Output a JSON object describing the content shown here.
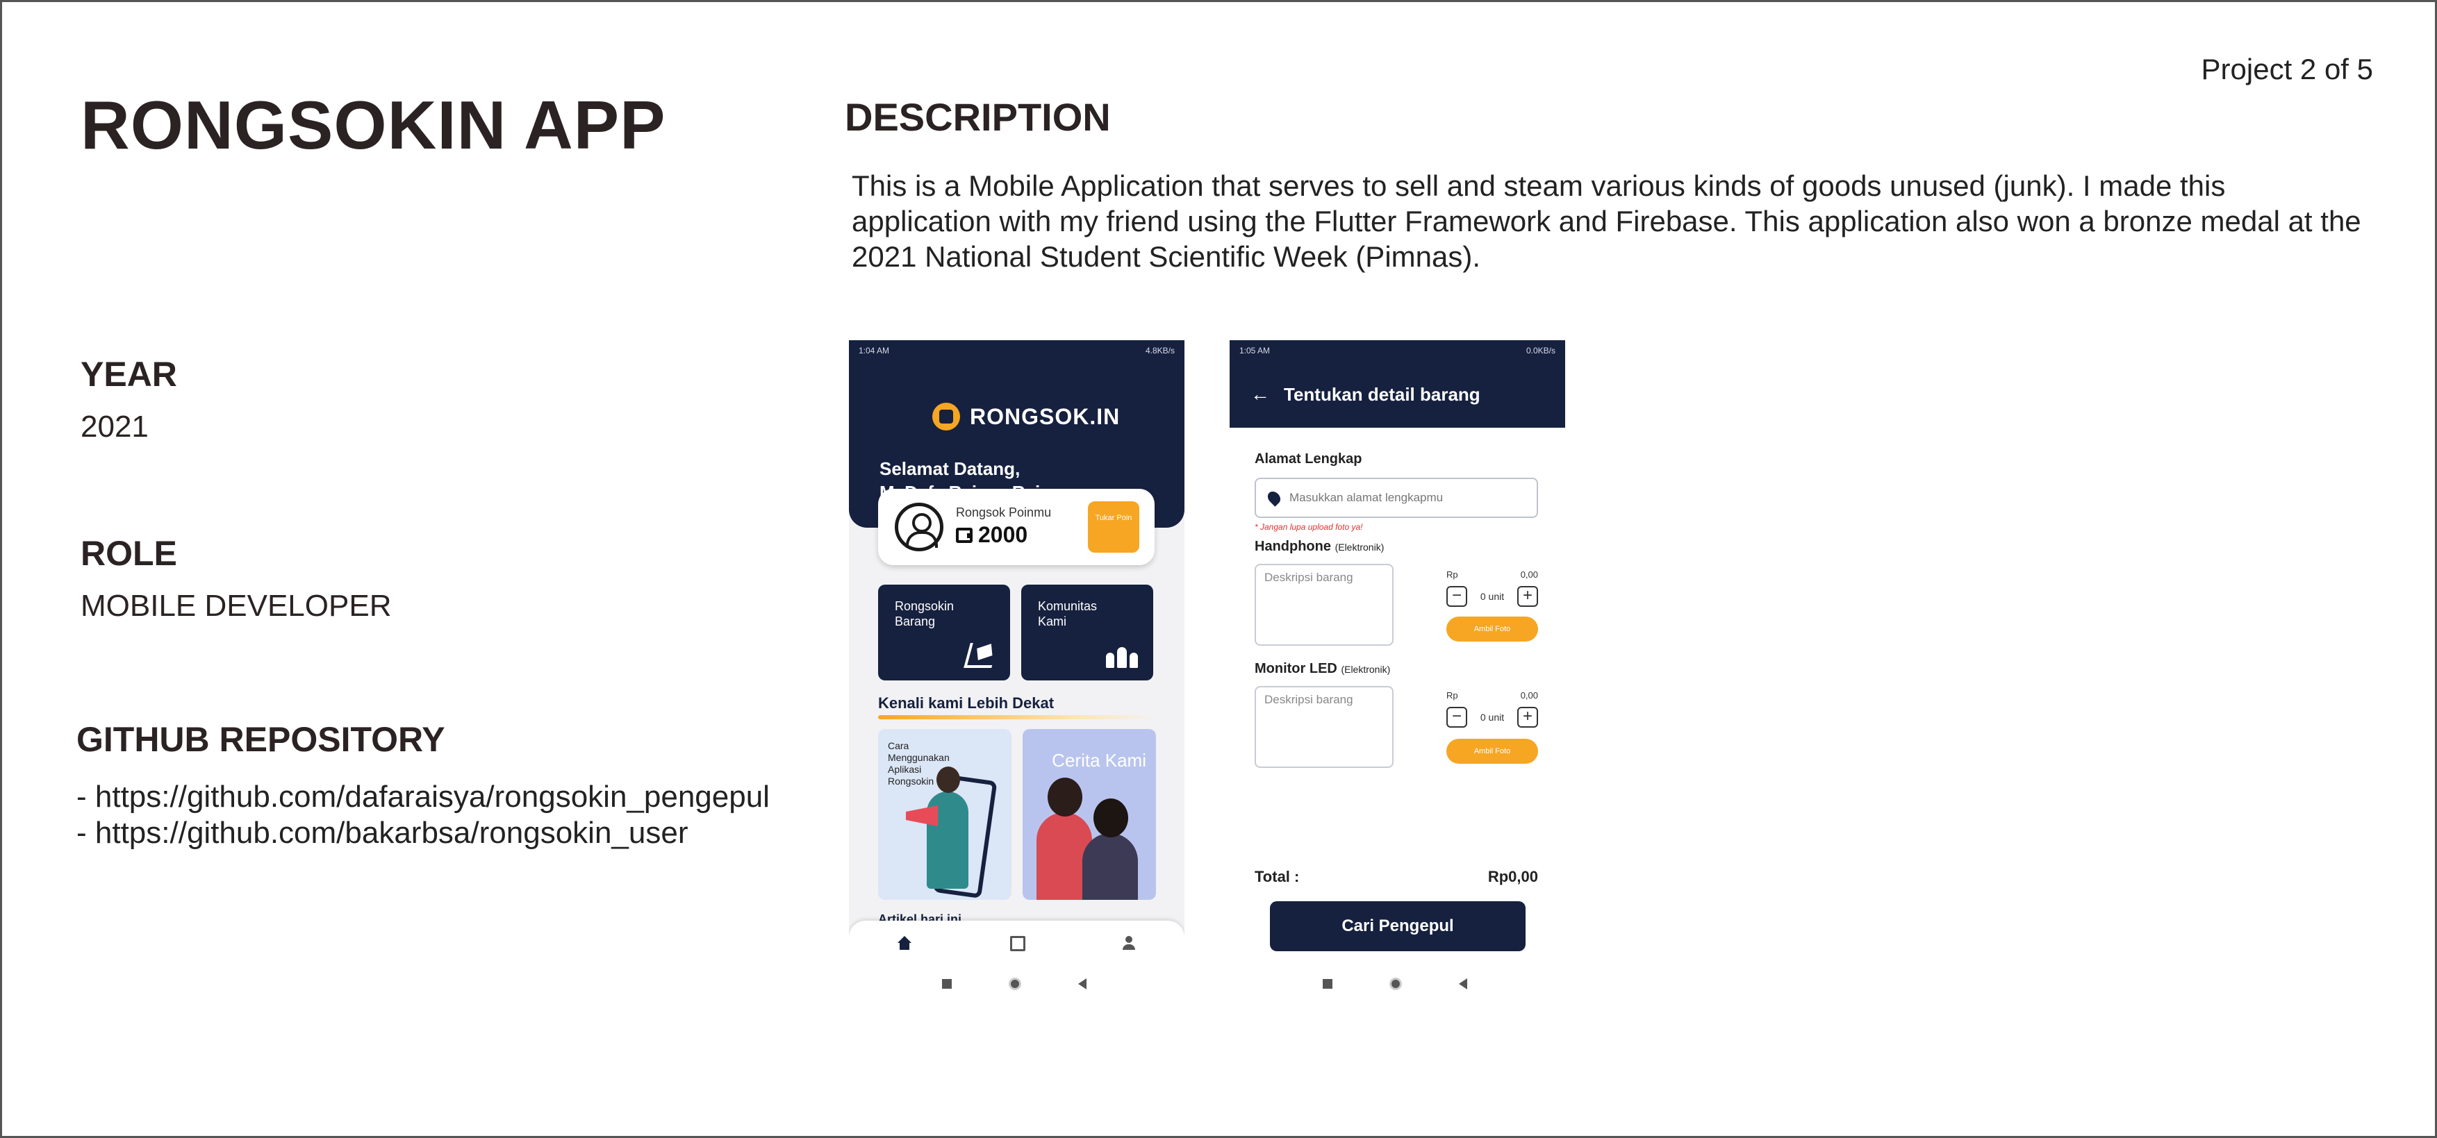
{
  "header": {
    "app_title": "RONGSOKIN APP",
    "project_counter": "Project 2 of 5"
  },
  "description": {
    "heading": "DESCRIPTION",
    "text": "This is a Mobile Application that serves to sell and steam various kinds of goods unused (junk). I made this application with my friend using the Flutter Framework and Firebase. This application also won a bronze medal at the 2021 National Student Scientific Week (Pimnas)."
  },
  "year": {
    "label": "YEAR",
    "value": "2021"
  },
  "role": {
    "label": "ROLE",
    "value": "MOBILE DEVELOPER"
  },
  "github": {
    "label": "GITHUB REPOSITORY",
    "links": [
      "- https://github.com/dafaraisya/rongsokin_pengepul",
      "- https://github.com/bakarbsa/rongsokin_user"
    ]
  },
  "phone_home": {
    "status_time": "1:04 AM",
    "status_info": "4.8KB/s",
    "brand": "RONGSOK.IN",
    "greeting_line1": "Selamat Datang,",
    "greeting_line2": "M. Dafa Raisya Rajwa",
    "points_label": "Rongsok Poinmu",
    "points_value": "2000",
    "swap_label": "Tukar Poin",
    "tiles": [
      {
        "label_line1": "Rongsokin",
        "label_line2": "Barang"
      },
      {
        "label_line1": "Komunitas",
        "label_line2": "Kami"
      }
    ],
    "section_title": "Kenali kami Lebih Dekat",
    "card_cara": [
      "Cara",
      "Menggunakan",
      "Aplikasi",
      "Rongsokin"
    ],
    "card_cerita": "Cerita Kami",
    "artikel": "Artikel hari ini"
  },
  "phone_detail": {
    "status_time": "1:05 AM",
    "status_info": "0.0KB/s",
    "header_title": "Tentukan detail barang",
    "address_label": "Alamat Lengkap",
    "address_placeholder": "Masukkan alamat lengkapmu",
    "warning": "* Jangan lupa upload foto ya!",
    "items": [
      {
        "name": "Handphone",
        "category": "(Elektronik)",
        "desc_placeholder": "Deskripsi barang",
        "currency": "Rp",
        "price": "0,00",
        "qty": "0 unit",
        "photo_label": "Ambil Foto"
      },
      {
        "name": "Monitor LED",
        "category": "(Elektronik)",
        "desc_placeholder": "Deskripsi barang",
        "currency": "Rp",
        "price": "0,00",
        "qty": "0 unit",
        "photo_label": "Ambil Foto"
      }
    ],
    "total_label": "Total :",
    "total_value": "Rp0,00",
    "cta": "Cari Pengepul"
  }
}
